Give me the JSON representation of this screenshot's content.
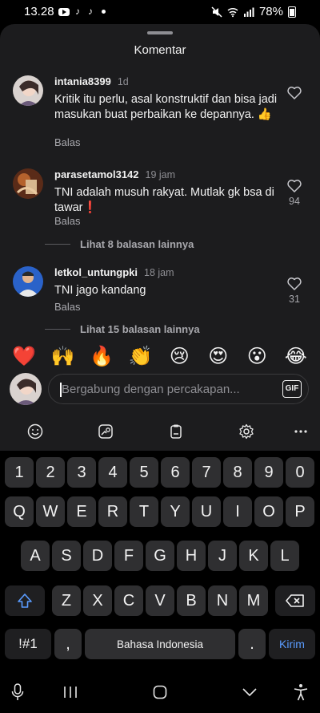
{
  "status_bar": {
    "time": "13.28",
    "battery": "78%"
  },
  "sheet": {
    "title": "Komentar"
  },
  "comments": [
    {
      "username": "intania8399",
      "time": "1d",
      "text": "Kritik itu perlu, asal konstruktif dan bisa jadi masukan buat perbaikan ke depannya. 👍",
      "reply_label": "Balas",
      "like_count": ""
    },
    {
      "username": "parasetamol3142",
      "time": "19 jam",
      "text": "TNI adalah musuh rakyat. Mutlak gk bsa di tawar❗",
      "reply_label": "Balas",
      "like_count": "94",
      "more_replies": "Lihat 8 balasan lainnya"
    },
    {
      "username": "letkol_untungpki",
      "time": "18 jam",
      "text": "TNI jago kandang",
      "reply_label": "Balas",
      "like_count": "31",
      "more_replies": "Lihat 15 balasan lainnya"
    }
  ],
  "emoji_bar": [
    "❤️",
    "🙌",
    "🔥",
    "👏",
    "😢",
    "😍",
    "😮",
    "😂"
  ],
  "input": {
    "placeholder": "Bergabung dengan percakapan...",
    "gif_label": "GIF"
  },
  "keyboard": {
    "number_row": [
      "1",
      "2",
      "3",
      "4",
      "5",
      "6",
      "7",
      "8",
      "9",
      "0"
    ],
    "row1": [
      "Q",
      "W",
      "E",
      "R",
      "T",
      "Y",
      "U",
      "I",
      "O",
      "P"
    ],
    "row2": [
      "A",
      "S",
      "D",
      "F",
      "G",
      "H",
      "J",
      "K",
      "L"
    ],
    "row3": [
      "Z",
      "X",
      "C",
      "V",
      "B",
      "N",
      "M"
    ],
    "symbols_label": "!#1",
    "comma_label": ",",
    "space_label": "Bahasa Indonesia",
    "period_label": ".",
    "send_label": "Kirim"
  },
  "colors": {
    "sheet_bg": "#1c1c1e",
    "key_bg": "#2f2f31",
    "send_accent": "#5a9cff",
    "like_red": "#e0245e"
  }
}
